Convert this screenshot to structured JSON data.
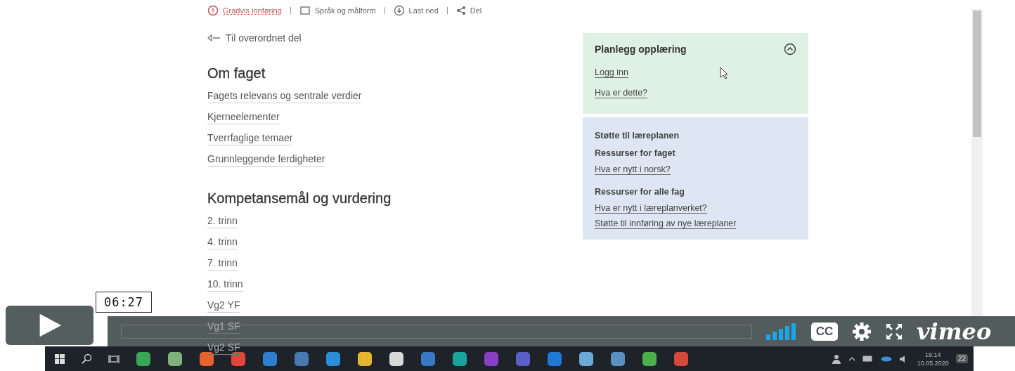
{
  "toolbar": [
    {
      "label": "Gradvis innføring",
      "kind": "warning"
    },
    {
      "label": "Språk og målform",
      "kind": "language"
    },
    {
      "label": "Last ned",
      "kind": "download"
    },
    {
      "label": "Del",
      "kind": "share"
    }
  ],
  "back_link": "Til overordnet del",
  "sections": [
    {
      "heading": "Om faget",
      "links": [
        "Fagets relevans og sentrale verdier",
        "Kjerneelementer",
        "Tverrfaglige temaer",
        "Grunnleggende ferdigheter"
      ]
    },
    {
      "heading": "Kompetansemål og vurdering",
      "links": [
        "2. trinn",
        "4. trinn",
        "7. trinn",
        "10. trinn",
        "Vg2 YF",
        "Vg1 SF",
        "Vg2 SF"
      ]
    }
  ],
  "plan_panel": {
    "title": "Planlegg opplæring",
    "expanded": true,
    "links": [
      "Logg inn",
      "Hva er dette?"
    ]
  },
  "support_panel": {
    "title": "Støtte til læreplanen",
    "groups": [
      {
        "heading": "Ressurser for faget",
        "links": [
          "Hva er nytt i norsk?"
        ]
      },
      {
        "heading": "Ressurser for alle fag",
        "links": [
          "Hva er nytt i læreplanverket?",
          "Støtte til innføring av nye læreplaner"
        ]
      }
    ]
  },
  "player": {
    "time": "06:27",
    "progress": {
      "level": 0
    },
    "captions": "CC",
    "logo": "vimeo"
  },
  "taskbar": {
    "time": "19:14",
    "date": "10.05.2020",
    "notifications": "22"
  }
}
